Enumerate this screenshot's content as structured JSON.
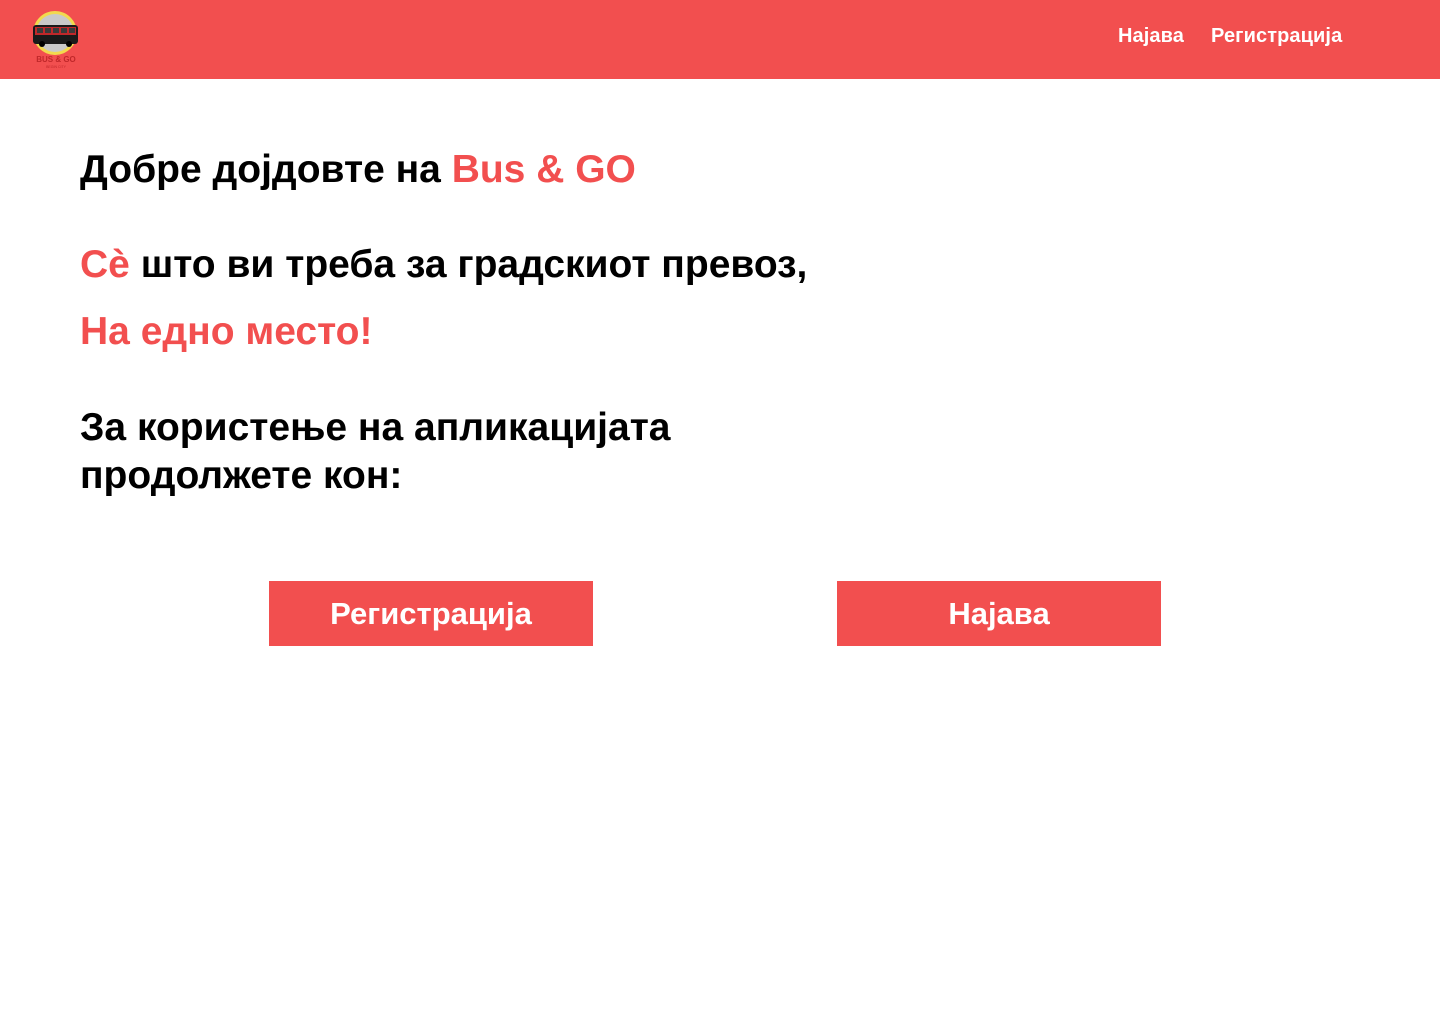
{
  "brand": {
    "logo_text": "BUS & GO",
    "logo_subtext": "BEGIN CITY",
    "accent_color": "#F24F4F"
  },
  "nav": {
    "login_label": "Најава",
    "register_label": "Регистрација"
  },
  "hero": {
    "welcome_prefix": "Добре дојдовте на ",
    "welcome_brand": "Bus & GO",
    "tagline_accent": "Сè",
    "tagline_rest": " што ви треба за градскиот превоз,",
    "tagline_line2": "На едно место!",
    "instruction": "За користење на апликацијата продолжете кон:"
  },
  "actions": {
    "register_label": "Регистрација",
    "login_label": "Најава"
  }
}
